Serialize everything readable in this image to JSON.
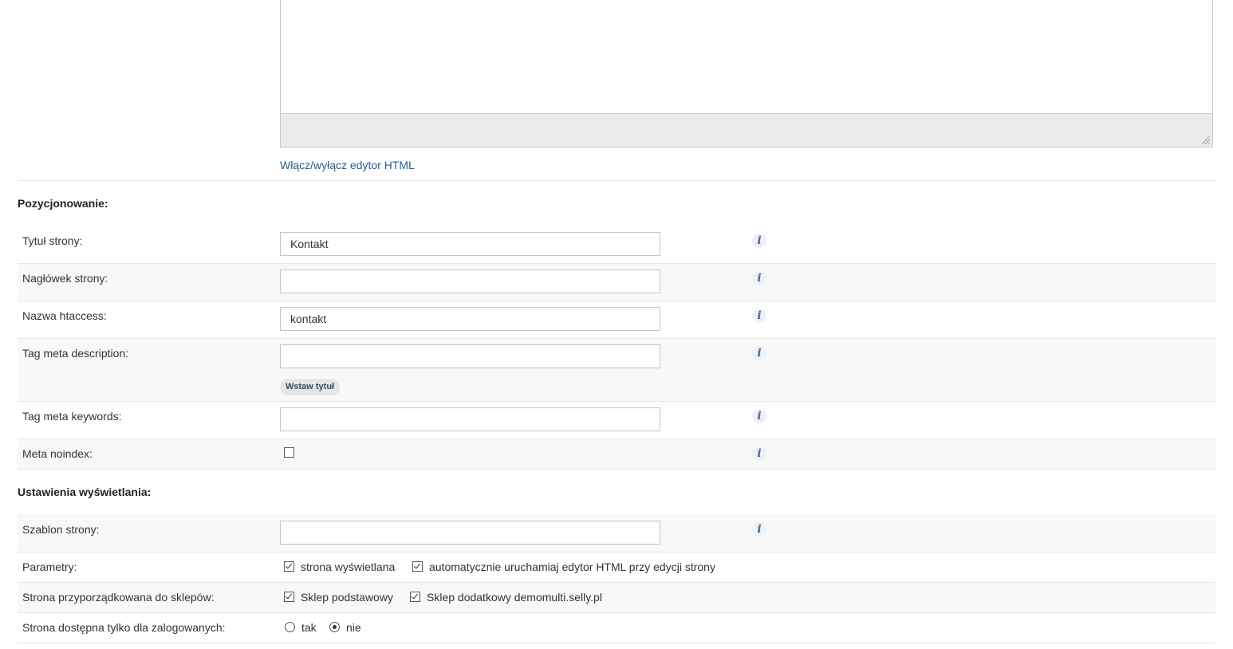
{
  "editor": {
    "toggle_link": "Włącz/wyłącz edytor HTML"
  },
  "seo": {
    "title": "Pozycjonowanie:",
    "page_title": {
      "label": "Tytuł strony:",
      "value": "Kontakt"
    },
    "page_header": {
      "label": "Nagłówek strony:",
      "value": ""
    },
    "htaccess": {
      "label": "Nazwa htaccess:",
      "value": "kontakt"
    },
    "meta_description": {
      "label": "Tag meta description:",
      "value": "",
      "insert_title_button": "Wstaw tytuł"
    },
    "meta_keywords": {
      "label": "Tag meta keywords:",
      "value": ""
    },
    "meta_noindex": {
      "label": "Meta noindex:",
      "checked": false
    },
    "info_icon": "i"
  },
  "display": {
    "title": "Ustawienia wyświetlania:",
    "template": {
      "label": "Szablon strony:",
      "value": ""
    },
    "params": {
      "label": "Parametry:",
      "options": [
        {
          "label": "strona wyświetlana",
          "checked": true
        },
        {
          "label": "automatycznie uruchamiaj edytor HTML przy edycji strony",
          "checked": true
        }
      ]
    },
    "shops": {
      "label": "Strona przyporządkowana do sklepów:",
      "options": [
        {
          "label": "Sklep podstawowy",
          "checked": true
        },
        {
          "label": "Sklep dodatkowy demomulti.selly.pl",
          "checked": true
        }
      ]
    },
    "logged_only": {
      "label": "Strona dostępna tylko dla zalogowanych:",
      "options": [
        {
          "label": "tak",
          "selected": false
        },
        {
          "label": "nie",
          "selected": true
        }
      ]
    }
  }
}
